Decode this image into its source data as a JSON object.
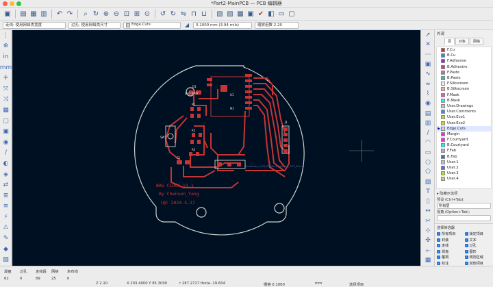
{
  "window": {
    "title": "*Part2-MainPCB — PCB 编辑器"
  },
  "toolbar": {
    "icons": [
      "save-icon",
      "board-setup-icon",
      "print-icon",
      "plot-icon",
      "undo-icon",
      "redo-icon",
      "search-icon",
      "refresh-icon",
      "zoom-in-icon",
      "zoom-out-icon",
      "zoom-fit-icon",
      "zoom-objects-icon",
      "zoom-area-icon",
      "rotate-ccw-icon",
      "rotate-cw-icon",
      "flip-icon",
      "lock-icon",
      "unlock-icon",
      "net-inspector-icon",
      "footprint-editor-icon",
      "footprint-browser-icon",
      "update-pcb-icon",
      "drc-icon",
      "layer-colors-icon",
      "script-icon",
      "plugin-icon"
    ]
  },
  "options": {
    "track_label": "走线: 使用网络类宽度",
    "via_label": "过孔: 使用网络类尺寸",
    "layer_value": "Edge.Cuts",
    "grid_value": "0.1000 mm (3.94 mils)",
    "zoom_value": "缩放倍数 2.20"
  },
  "panel": {
    "title": "外观",
    "tabs": [
      "层",
      "对象",
      "网络"
    ],
    "layers": [
      {
        "name": "F.Cu",
        "color": "#c83434"
      },
      {
        "name": "B.Cu",
        "color": "#4d7fc4"
      },
      {
        "name": "F.Adhesive",
        "color": "#8434c8"
      },
      {
        "name": "B.Adhesive",
        "color": "#cc3c8c"
      },
      {
        "name": "F.Paste",
        "color": "#b4749c"
      },
      {
        "name": "B.Paste",
        "color": "#46b4b4"
      },
      {
        "name": "F.Silkscreen",
        "color": "#f2ede1"
      },
      {
        "name": "B.Silkscreen",
        "color": "#e8b2a7"
      },
      {
        "name": "F.Mask",
        "color": "#d864a6"
      },
      {
        "name": "B.Mask",
        "color": "#02ffee"
      },
      {
        "name": "User.Drawings",
        "color": "#c2c2c2"
      },
      {
        "name": "User.Comments",
        "color": "#5985d4"
      },
      {
        "name": "User.Eco1",
        "color": "#b4db3e"
      },
      {
        "name": "User.Eco2",
        "color": "#d8c852"
      },
      {
        "name": "Edge.Cuts",
        "color": "#d0d2cd"
      },
      {
        "name": "Margin",
        "color": "#ff26e2"
      },
      {
        "name": "F.Courtyard",
        "color": "#ff26e2"
      },
      {
        "name": "B.Courtyard",
        "color": "#26e9ff"
      },
      {
        "name": "F.Fab",
        "color": "#afafaf"
      },
      {
        "name": "B.Fab",
        "color": "#5869b0"
      },
      {
        "name": "User.1",
        "color": "#c2c2c2"
      },
      {
        "name": "User.2",
        "color": "#596fd4"
      },
      {
        "name": "User.3",
        "color": "#b4db3e"
      },
      {
        "name": "User.4",
        "color": "#d8c852"
      }
    ],
    "selected_layer": "Edge.Cuts",
    "low_contrast": "▸ 隐藏示选项",
    "preset_label": "预设 (Ctrl+Tab):",
    "preset_value": "所有层",
    "viewport_label": "视角 (Option+Tab):",
    "viewport_value": "",
    "filter_title": "选择筛选器",
    "filters": [
      "所有项目",
      "锁定项目",
      "封装",
      "文本",
      "走线",
      "过孔",
      "焊盘",
      "图形",
      "覆铜",
      "规则区域",
      "标注",
      "其他项目"
    ]
  },
  "canvas": {
    "silk_lines": [
      "BAG CLOCK V1.1",
      "By Chenxen_Yang",
      "(@) 2024.5.27"
    ],
    "refs": [
      "D1",
      "U1",
      "M1",
      "J1",
      "SW1",
      "R1",
      "R2",
      "R3",
      "C1"
    ],
    "connector_label": "PinHeader_1x03_P2.54mm_Vertical_THT_D1mm",
    "smd_label": "LED_SMD"
  },
  "status": {
    "items": [
      {
        "label": "焊盘",
        "value": "62"
      },
      {
        "label": "过孔",
        "value": "0"
      },
      {
        "label": "走线段",
        "value": "89"
      },
      {
        "label": "网络",
        "value": "25"
      },
      {
        "label": "未布线",
        "value": "0"
      }
    ],
    "z": "Z 2.10",
    "xy": "X 203.4000  Y 85.3000",
    "dxy": "r 287.2717  theta -19.604",
    "grid": "栅格 0.1000",
    "unit": "mm",
    "mode": "选择项目"
  },
  "colors": {
    "canvas_bg": "#001023",
    "copper": "#c83434",
    "edge": "#d0d2cd",
    "silk": "#f2ede1"
  }
}
